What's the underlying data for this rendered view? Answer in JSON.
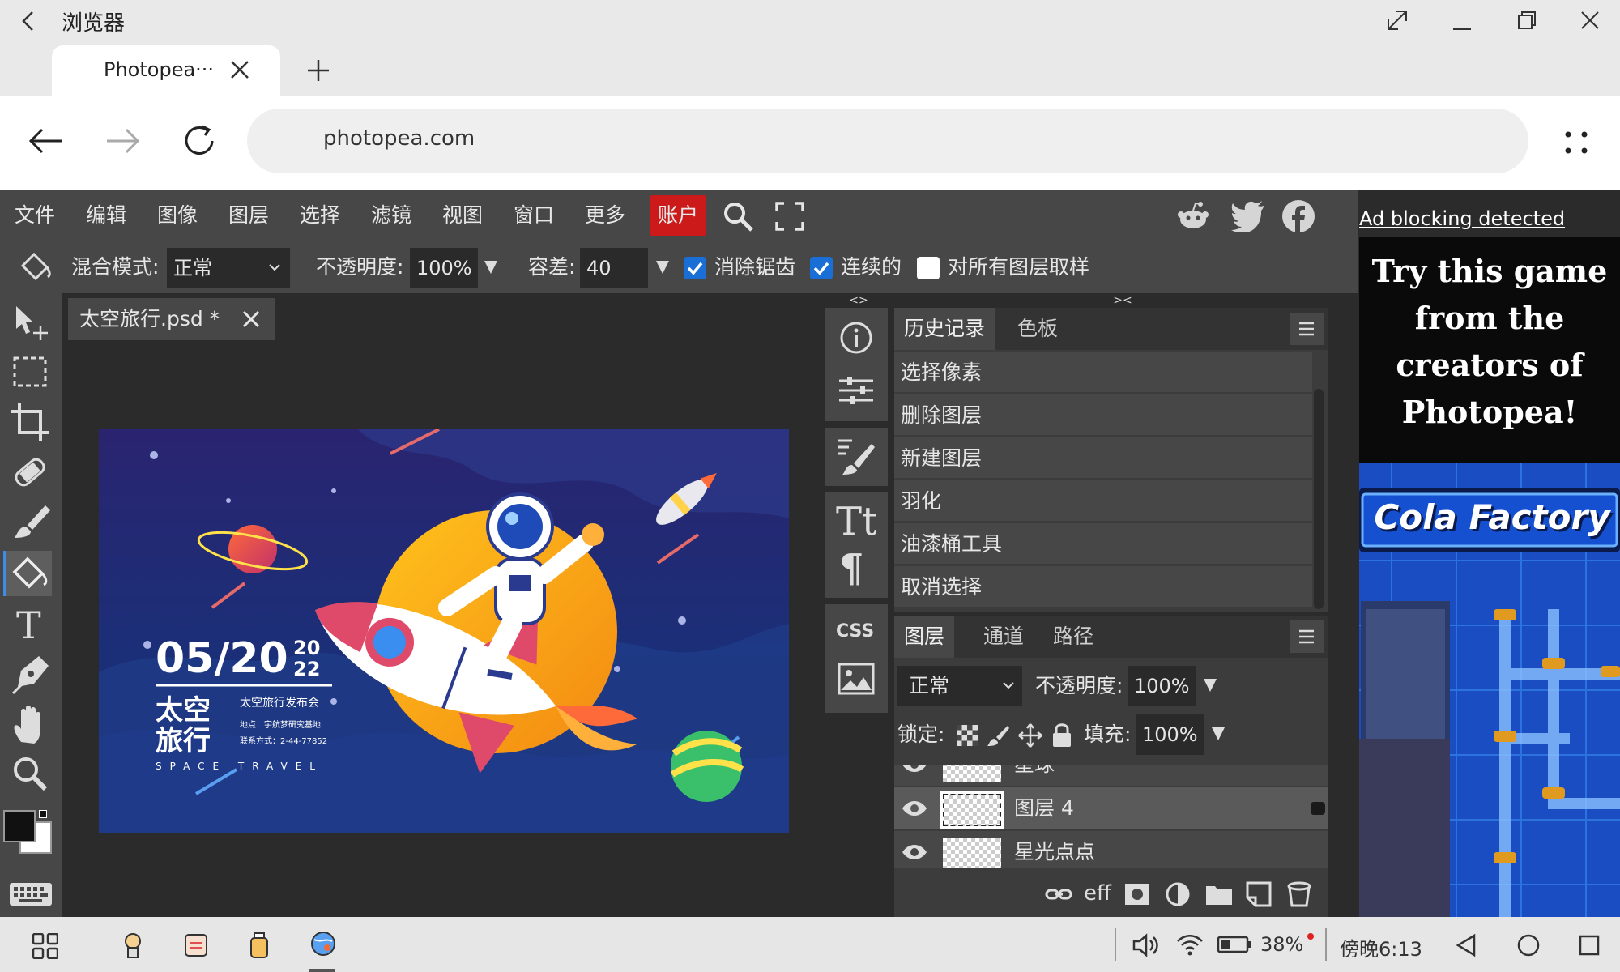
{
  "browser": {
    "app_name": "浏览器",
    "tab_title": "Photopea···",
    "url": "photopea.com"
  },
  "menu": {
    "items": [
      "文件",
      "编辑",
      "图像",
      "图层",
      "选择",
      "滤镜",
      "视图",
      "窗口",
      "更多"
    ],
    "account": "账户"
  },
  "options": {
    "blend_label": "混合模式:",
    "blend_value": "正常",
    "opacity_label": "不透明度:",
    "opacity_value": "100%",
    "tolerance_label": "容差:",
    "tolerance_value": "40",
    "antialias_label": "消除锯齿",
    "contiguous_label": "连续的",
    "all_layers_label": "对所有图层取样"
  },
  "document": {
    "tab_title": "太空旅行.psd *"
  },
  "poster": {
    "date": "05/20",
    "year_top": "20",
    "year_bottom": "22",
    "title_line1": "太空",
    "title_line2": "旅行",
    "subtitle": "太空旅行发布会",
    "address": "地点：宇航梦研究基地",
    "contact": "联系方式：2-44-77852",
    "tagline": "SPACE TRAVEL"
  },
  "strip": {
    "collapse_left": "<>",
    "collapse_right": "><"
  },
  "history_panel": {
    "tabs": [
      "历史记录",
      "色板"
    ],
    "rows": [
      "选择像素",
      "删除图层",
      "新建图层",
      "羽化",
      "油漆桶工具",
      "取消选择"
    ]
  },
  "layers_panel": {
    "tabs": [
      "图层",
      "通道",
      "路径"
    ],
    "blend_value": "正常",
    "opacity_label": "不透明度:",
    "opacity_value": "100%",
    "lock_label": "锁定:",
    "fill_label": "填充:",
    "fill_value": "100%",
    "rows": [
      "星球",
      "图层 4",
      "星光点点"
    ],
    "footer_eff": "eff"
  },
  "ad": {
    "notice": "Ad blocking detected",
    "headline": "Try this game from the creators of Photopea!",
    "game_title": "Cola Factory"
  },
  "taskbar": {
    "battery": "38%",
    "time": "傍晚6:13"
  },
  "colors": {
    "accent_blue": "#1a6fd6",
    "account_red": "#cc1a1a",
    "panel_bg": "#474747",
    "workspace_bg": "#2b2b2b"
  }
}
